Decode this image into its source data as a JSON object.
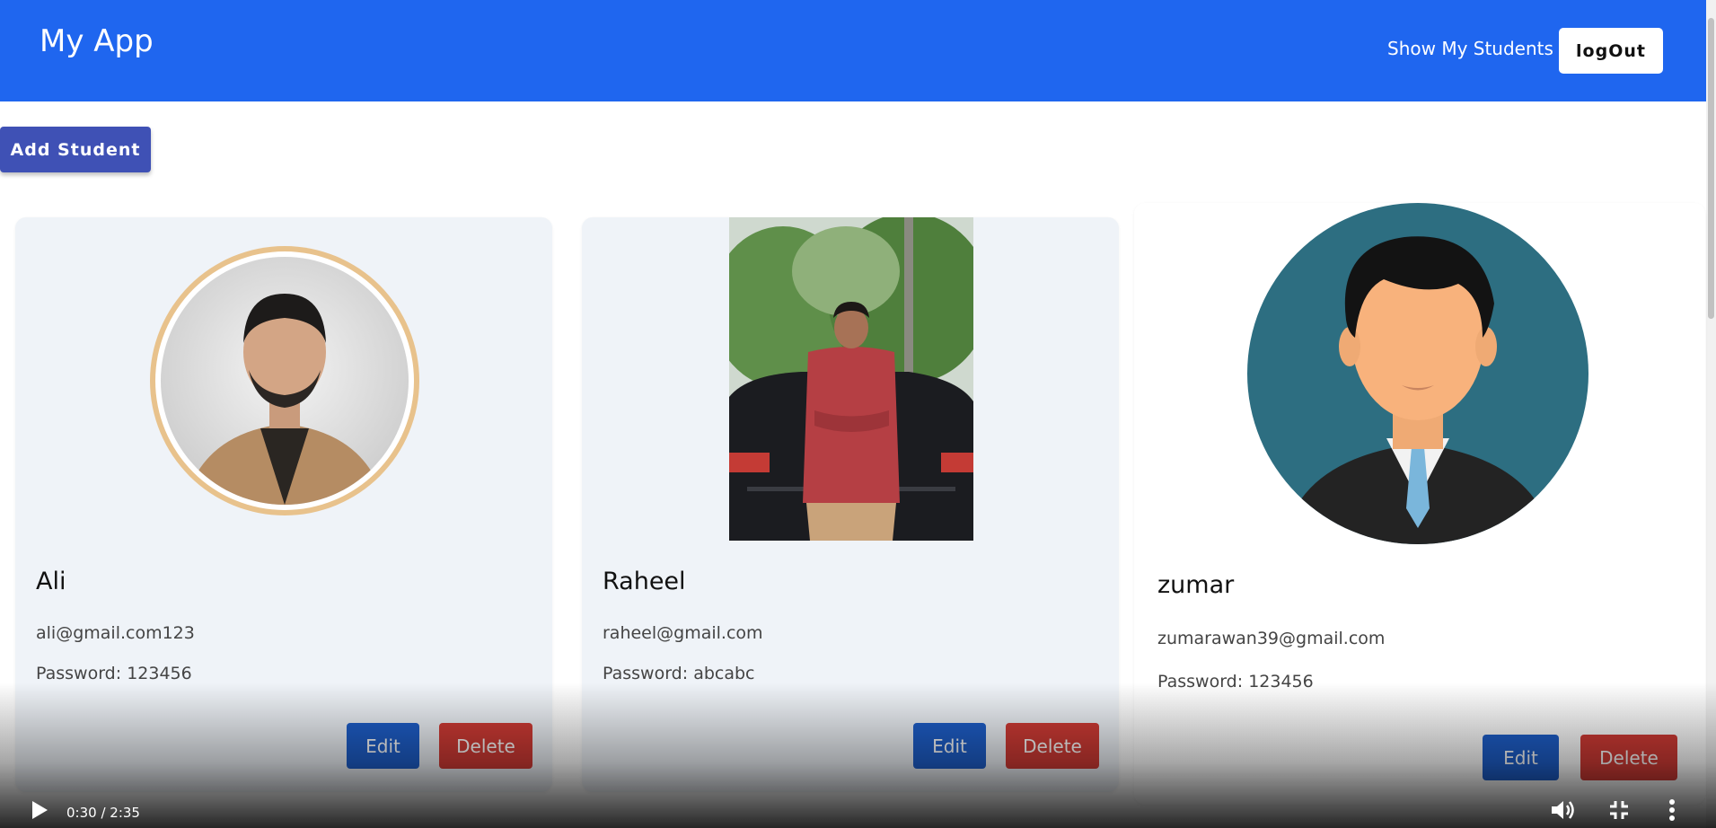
{
  "header": {
    "title": "My App",
    "nav_link": "Show My Students",
    "logout_label": "logOut"
  },
  "toolbar": {
    "add_label": "Add Student"
  },
  "students": [
    {
      "name": "Ali",
      "email": "ali@gmail.com123",
      "password": "Password: 123456",
      "edit_label": "Edit",
      "delete_label": "Delete"
    },
    {
      "name": "Raheel",
      "email": "raheel@gmail.com",
      "password": "Password: abcabc",
      "edit_label": "Edit",
      "delete_label": "Delete"
    },
    {
      "name": "zumar",
      "email": "zumarawan39@gmail.com",
      "password": "Password: 123456",
      "edit_label": "Edit",
      "delete_label": "Delete"
    }
  ],
  "video": {
    "time": "0:30 / 2:35"
  },
  "colors": {
    "app_bar": "#1f66ef",
    "add_button": "#3f51b5",
    "edit_button": "#1e5fcb",
    "delete_button": "#d13b35",
    "card_bg": "#eff3f8"
  },
  "icons": [
    "play-icon",
    "volume-icon",
    "fullscreen-exit-icon",
    "more-vert-icon"
  ]
}
